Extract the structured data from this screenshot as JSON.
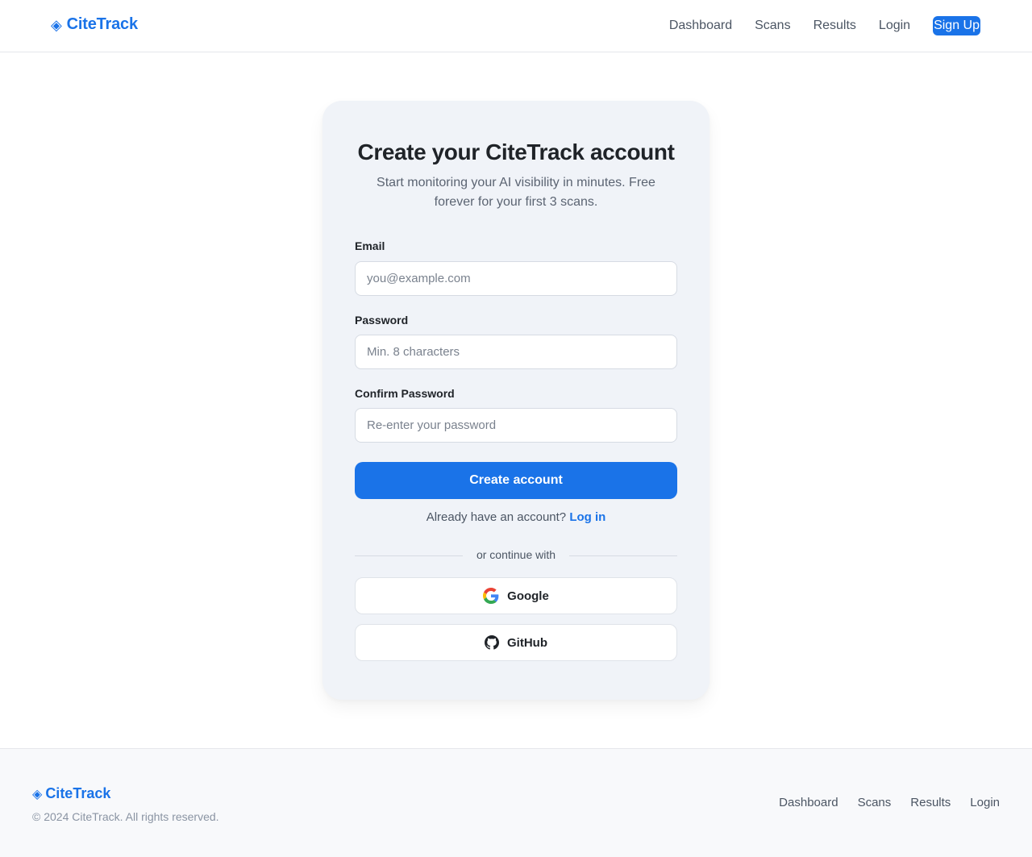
{
  "brand": {
    "name": "CiteTrack",
    "color": "#1a73e8"
  },
  "header": {
    "nav": [
      {
        "label": "Dashboard"
      },
      {
        "label": "Scans"
      },
      {
        "label": "Results"
      },
      {
        "label": "Login"
      }
    ],
    "signup_label": "Sign Up"
  },
  "form": {
    "title": "Create your CiteTrack account",
    "subtitle": "Start monitoring your AI visibility in minutes. Free forever for your first 3 scans.",
    "email": {
      "label": "Email",
      "placeholder": "you@example.com",
      "value": ""
    },
    "password": {
      "label": "Password",
      "placeholder": "Min. 8 characters",
      "value": ""
    },
    "confirm_password": {
      "label": "Confirm Password",
      "placeholder": "Re-enter your password",
      "value": ""
    },
    "submit_label": "Create account",
    "login_prompt": "Already have an account?",
    "login_link": "Log in",
    "divider_text": "or continue with",
    "oauth": {
      "google": {
        "label": "Google",
        "icon": "google-icon"
      },
      "github": {
        "label": "GitHub",
        "icon": "github-icon"
      }
    }
  },
  "footer": {
    "copyright": "© 2024 CiteTrack. All rights reserved.",
    "nav": [
      {
        "label": "Dashboard"
      },
      {
        "label": "Scans"
      },
      {
        "label": "Results"
      },
      {
        "label": "Login"
      }
    ]
  }
}
